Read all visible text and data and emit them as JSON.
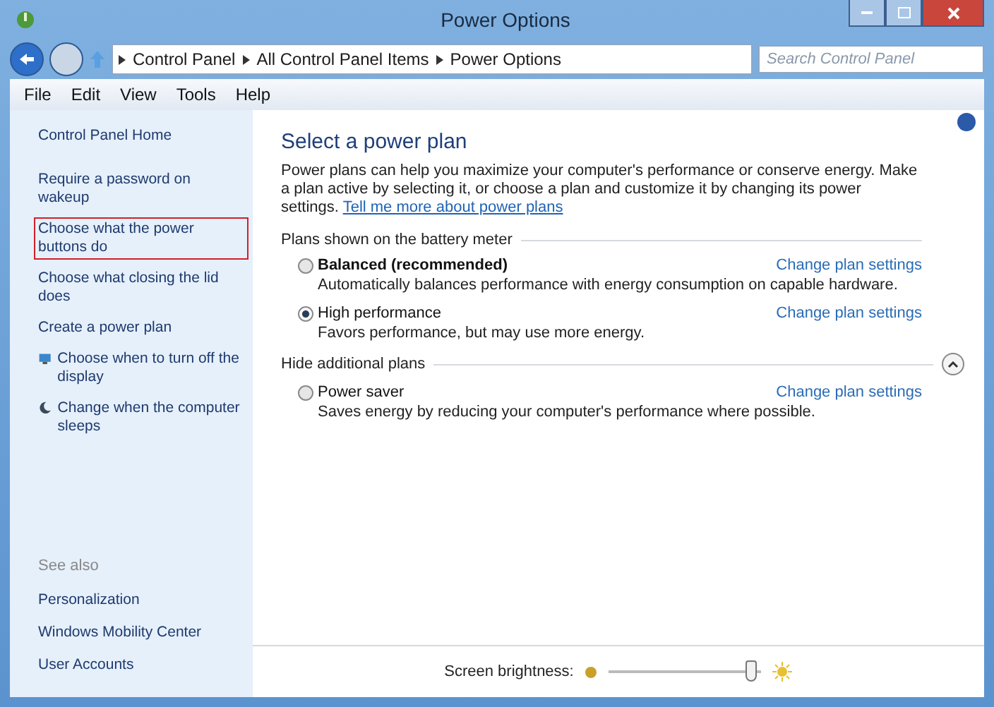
{
  "window": {
    "title": "Power Options"
  },
  "address": {
    "crumbs": [
      "Control Panel",
      "All Control Panel Items",
      "Power Options"
    ],
    "search_placeholder": "Search Control Panel"
  },
  "menu": [
    "File",
    "Edit",
    "View",
    "Tools",
    "Help"
  ],
  "sidebar": {
    "home": "Control Panel Home",
    "tasks": [
      {
        "label": "Require a password on wakeup",
        "highlighted": false,
        "kind": "plain"
      },
      {
        "label": "Choose what the power buttons do",
        "highlighted": true,
        "kind": "plain"
      },
      {
        "label": "Choose what closing the lid does",
        "highlighted": false,
        "kind": "plain"
      },
      {
        "label": "Create a power plan",
        "highlighted": false,
        "kind": "plain"
      },
      {
        "label": "Choose when to turn off the display",
        "highlighted": false,
        "kind": "display"
      },
      {
        "label": "Change when the computer sleeps",
        "highlighted": false,
        "kind": "sleep"
      }
    ],
    "see_also": {
      "title": "See also",
      "links": [
        "Personalization",
        "Windows Mobility Center",
        "User Accounts"
      ]
    }
  },
  "main": {
    "heading": "Select a power plan",
    "intro": "Power plans can help you maximize your computer's performance or conserve energy. Make a plan active by selecting it, or choose a plan and customize it by changing its power settings.",
    "intro_link": "Tell me more about power plans",
    "groups": [
      {
        "title": "Plans shown on the battery meter",
        "plans": [
          {
            "name": "Balanced (recommended)",
            "recommended": true,
            "selected": false,
            "description": "Automatically balances performance with energy consumption on capable hardware.",
            "link": "Change plan settings"
          },
          {
            "name": "High performance",
            "recommended": false,
            "selected": true,
            "description": "Favors performance, but may use more energy.",
            "link": "Change plan settings"
          }
        ]
      },
      {
        "title": "Hide additional plans",
        "expanded": true,
        "plans": [
          {
            "name": "Power saver",
            "recommended": false,
            "selected": false,
            "description": "Saves energy by reducing your computer's performance where possible.",
            "link": "Change plan settings"
          }
        ]
      }
    ]
  },
  "brightness": {
    "label": "Screen brightness:",
    "level": 0.97
  }
}
